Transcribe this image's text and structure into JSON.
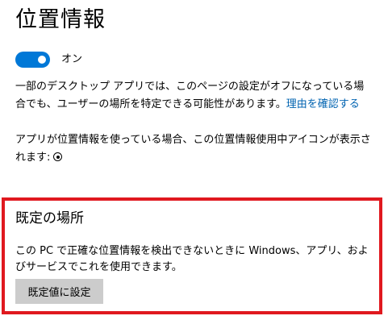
{
  "page": {
    "title": "位置情報"
  },
  "location_toggle": {
    "state_label": "オン",
    "on": true,
    "accent_color": "#0078d7"
  },
  "info": {
    "paragraph_1": "一部のデスクトップ アプリでは、このページの設定がオフになっている場合でも、ユーザーの場所を特定できる可能性があります。",
    "learn_more_link": "理由を確認する",
    "paragraph_2": "アプリが位置情報を使っている場合、この位置情報使用中アイコンが表示されます:",
    "location_in_use_icon": "location-in-use-icon"
  },
  "default_location": {
    "heading": "既定の場所",
    "description": "この PC で正確な位置情報を検出できないときに Windows、アプリ、およびサービスでこれを使用できます。",
    "set_default_button": "既定値に設定",
    "highlight_color": "#e0191f"
  }
}
